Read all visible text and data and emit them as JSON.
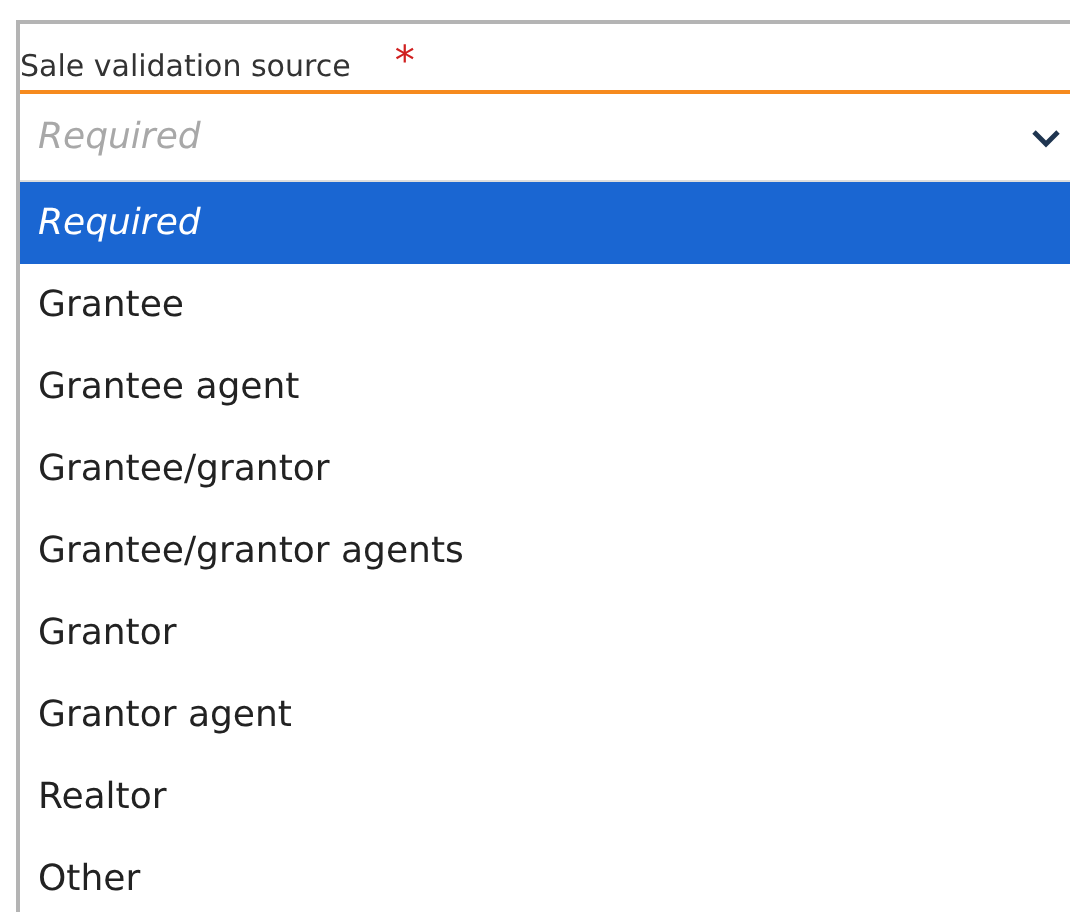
{
  "field": {
    "label": "Sale validation source",
    "required_mark": "*",
    "placeholder": "Required"
  },
  "options": [
    {
      "label": "Required",
      "selected": true,
      "kind": "placeholder"
    },
    {
      "label": "Grantee",
      "selected": false,
      "kind": "value"
    },
    {
      "label": "Grantee agent",
      "selected": false,
      "kind": "value"
    },
    {
      "label": "Grantee/grantor",
      "selected": false,
      "kind": "value"
    },
    {
      "label": "Grantee/grantor agents",
      "selected": false,
      "kind": "value"
    },
    {
      "label": "Grantor",
      "selected": false,
      "kind": "value"
    },
    {
      "label": "Grantor agent",
      "selected": false,
      "kind": "value"
    },
    {
      "label": "Realtor",
      "selected": false,
      "kind": "value"
    },
    {
      "label": "Other",
      "selected": false,
      "kind": "value"
    }
  ]
}
